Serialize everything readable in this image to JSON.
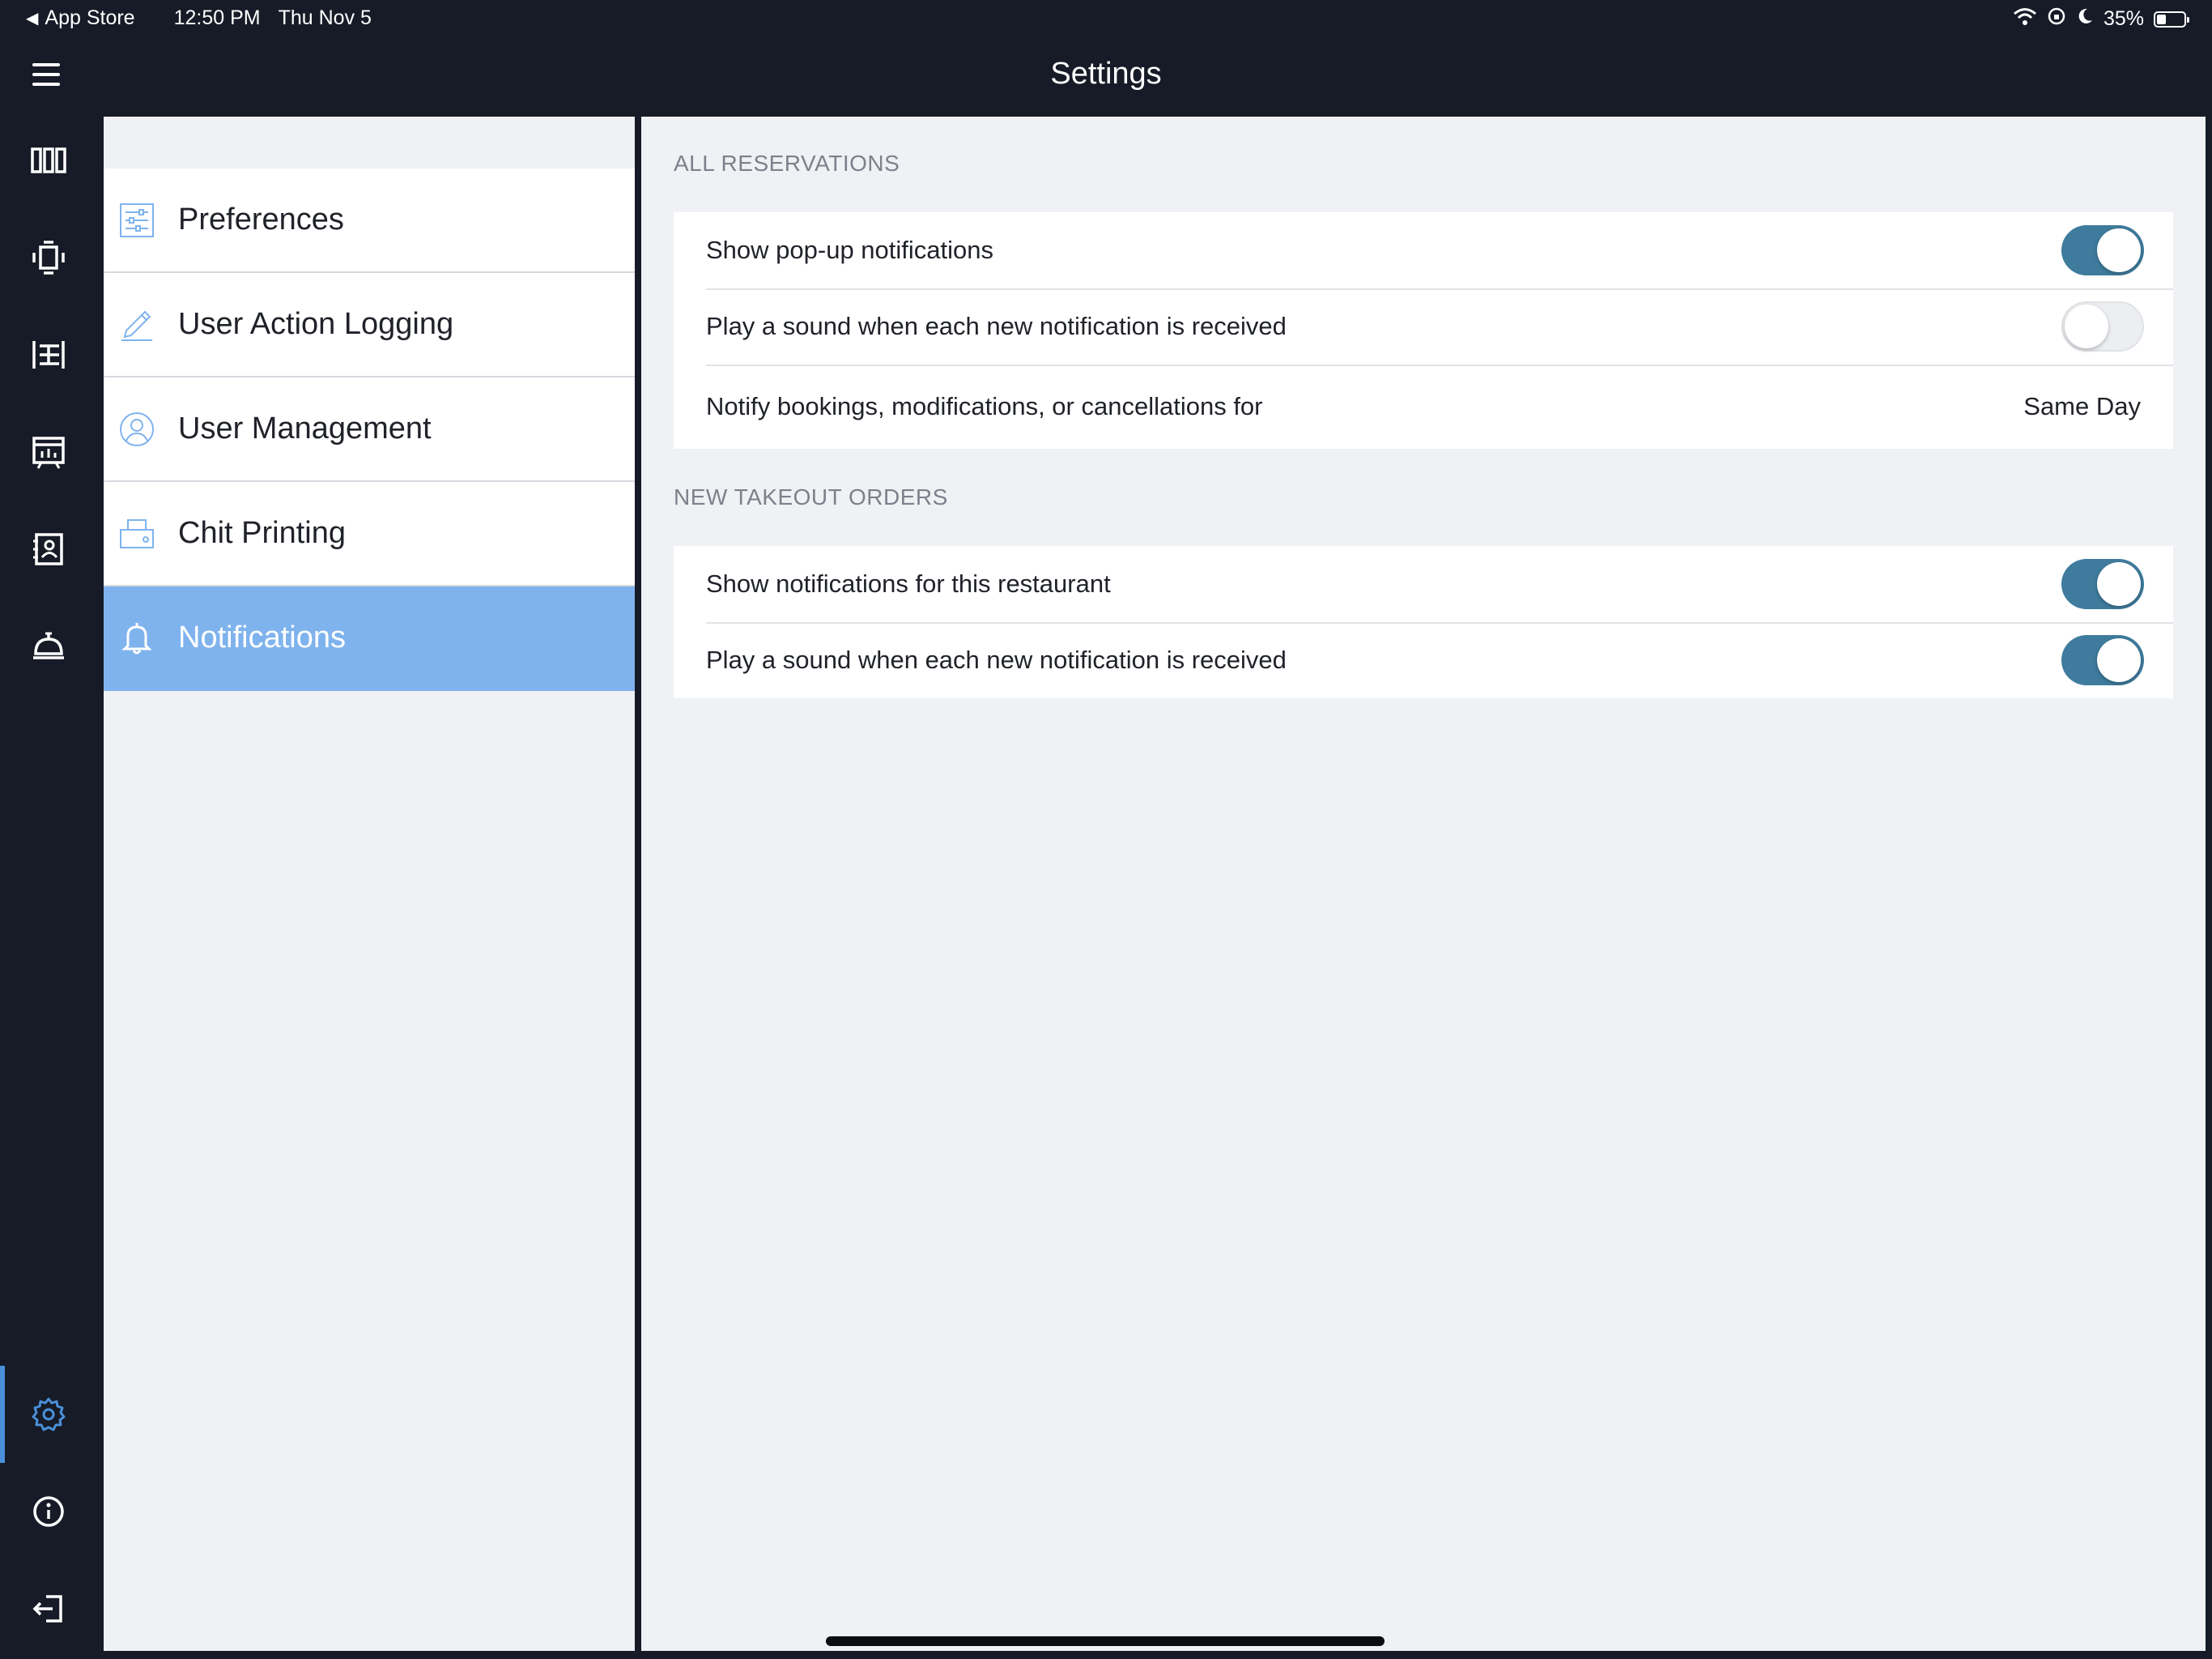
{
  "status_bar": {
    "back_app": "App Store",
    "time": "12:50 PM",
    "date": "Thu Nov 5",
    "battery": "35%"
  },
  "header": {
    "title": "Settings",
    "menu_icon": "hamburger-menu-icon"
  },
  "rail": {
    "items": [
      {
        "name": "reservations-columns-icon"
      },
      {
        "name": "waitlist-icon"
      },
      {
        "name": "floor-plan-icon"
      },
      {
        "name": "reports-calendar-icon"
      },
      {
        "name": "guest-book-icon"
      },
      {
        "name": "takeout-bell-icon"
      },
      {
        "name": "settings-gear-icon",
        "active": true
      },
      {
        "name": "info-icon"
      },
      {
        "name": "logout-icon"
      }
    ],
    "accent": "#4a90d9"
  },
  "settings_menu": {
    "items": [
      {
        "label": "Preferences",
        "icon": "sliders-icon"
      },
      {
        "label": "User Action Logging",
        "icon": "pencil-icon"
      },
      {
        "label": "User Management",
        "icon": "user-circle-icon"
      },
      {
        "label": "Chit Printing",
        "icon": "printer-icon"
      },
      {
        "label": "Notifications",
        "icon": "bell-icon",
        "active": true
      }
    ],
    "active_color": "#7fb3ee"
  },
  "detail": {
    "sections": [
      {
        "heading": "ALL RESERVATIONS",
        "rows": [
          {
            "label": "Show pop-up notifications",
            "toggle": true
          },
          {
            "label": "Play a sound when each new notification is received",
            "toggle": false
          },
          {
            "label": "Notify bookings, modifications, or cancellations for",
            "value": "Same Day"
          }
        ]
      },
      {
        "heading": "NEW TAKEOUT ORDERS",
        "rows": [
          {
            "label": "Show notifications for this restaurant",
            "toggle": true
          },
          {
            "label": "Play a sound when each new notification is received",
            "toggle": true
          }
        ]
      }
    ],
    "toggle_on_color": "#3e7b9c"
  }
}
